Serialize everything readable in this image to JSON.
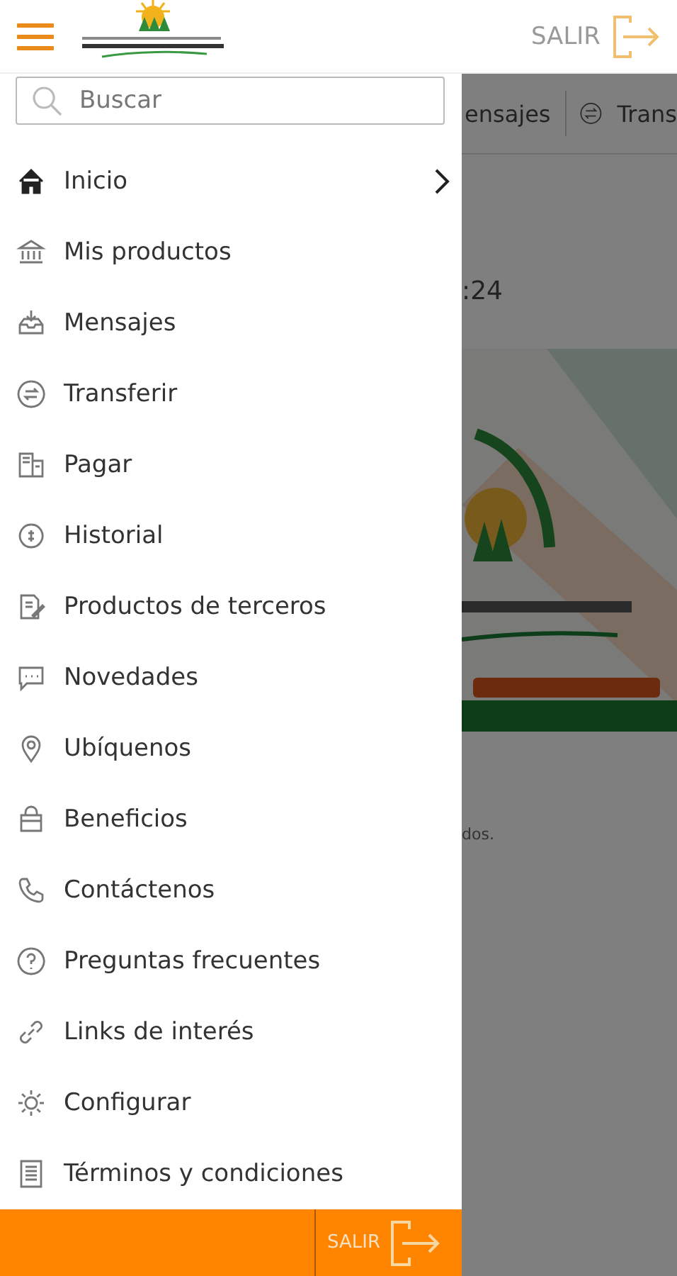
{
  "header": {
    "logout": "SALIR"
  },
  "search": {
    "placeholder": "Buscar"
  },
  "menu": [
    {
      "label": "Inicio",
      "chevron": true
    },
    {
      "label": "Mis productos",
      "chevron": false
    },
    {
      "label": "Mensajes",
      "chevron": false
    },
    {
      "label": "Transferir",
      "chevron": false
    },
    {
      "label": "Pagar",
      "chevron": false
    },
    {
      "label": "Historial",
      "chevron": false
    },
    {
      "label": "Productos de terceros",
      "chevron": false
    },
    {
      "label": "Novedades",
      "chevron": false
    },
    {
      "label": "Ubíquenos",
      "chevron": false
    },
    {
      "label": "Beneficios",
      "chevron": false
    },
    {
      "label": "Contáctenos",
      "chevron": false
    },
    {
      "label": "Preguntas frecuentes",
      "chevron": false
    },
    {
      "label": "Links de interés",
      "chevron": false
    },
    {
      "label": "Configurar",
      "chevron": false
    },
    {
      "label": "Términos y condiciones",
      "chevron": false
    }
  ],
  "footer": {
    "logout": "SALIR"
  },
  "background": {
    "tabs": [
      "ensajes",
      "Trans"
    ],
    "time": ":24",
    "note": "dos."
  }
}
